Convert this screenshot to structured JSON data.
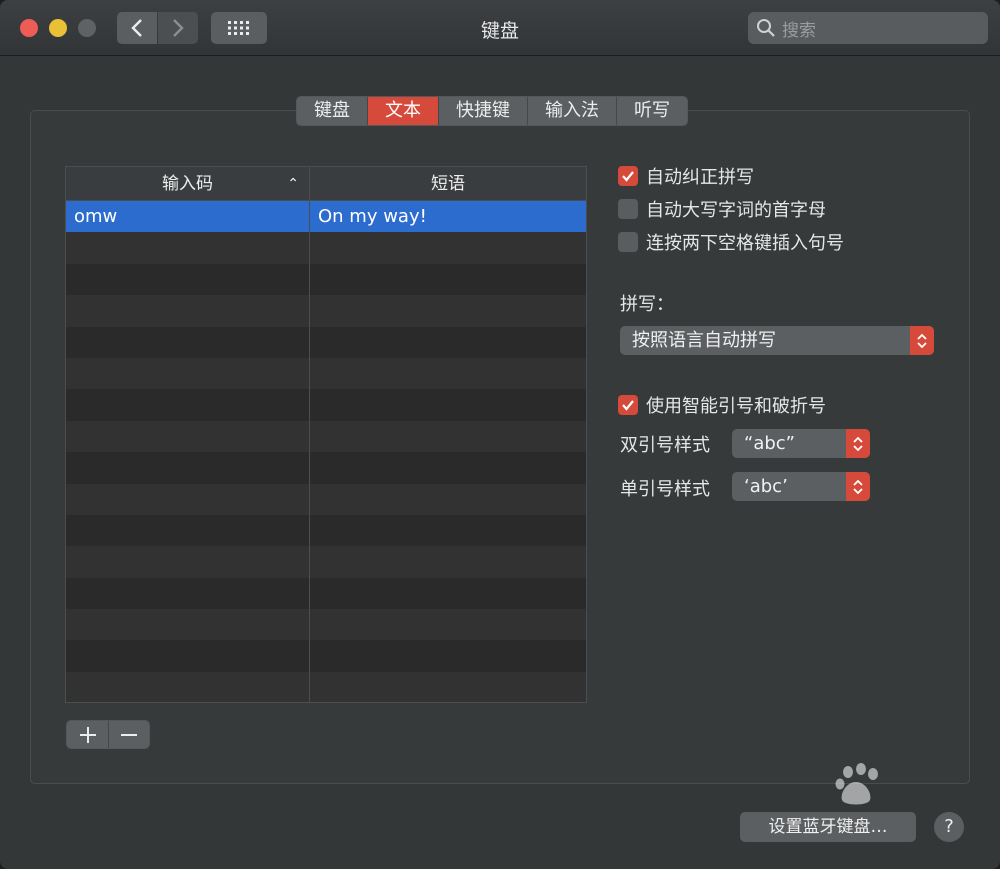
{
  "window": {
    "title": "键盘"
  },
  "search": {
    "placeholder": "搜索"
  },
  "tabs": [
    {
      "label": "键盘",
      "active": false
    },
    {
      "label": "文本",
      "active": true
    },
    {
      "label": "快捷键",
      "active": false
    },
    {
      "label": "输入法",
      "active": false
    },
    {
      "label": "听写",
      "active": false
    }
  ],
  "table": {
    "headers": [
      "输入码",
      "短语"
    ],
    "rows": [
      {
        "input": "omw",
        "phrase": "On my way!",
        "selected": true
      }
    ]
  },
  "options": {
    "autocorrect": {
      "label": "自动纠正拼写",
      "checked": true
    },
    "autocap": {
      "label": "自动大写字词的首字母",
      "checked": false
    },
    "doublespace": {
      "label": "连按两下空格键插入句号",
      "checked": false
    },
    "spelling_label": "拼写：",
    "spelling_value": "按照语言自动拼写",
    "smartquotes": {
      "label": "使用智能引号和破折号",
      "checked": true
    },
    "double_quote_label": "双引号样式",
    "double_quote_value": "“abc”",
    "single_quote_label": "单引号样式",
    "single_quote_value": "‘abc’"
  },
  "footer": {
    "bluetooth_button": "设置蓝牙键盘…",
    "help": "?"
  },
  "colors": {
    "accent": "#d64a3b",
    "selection": "#2d6ccf"
  }
}
